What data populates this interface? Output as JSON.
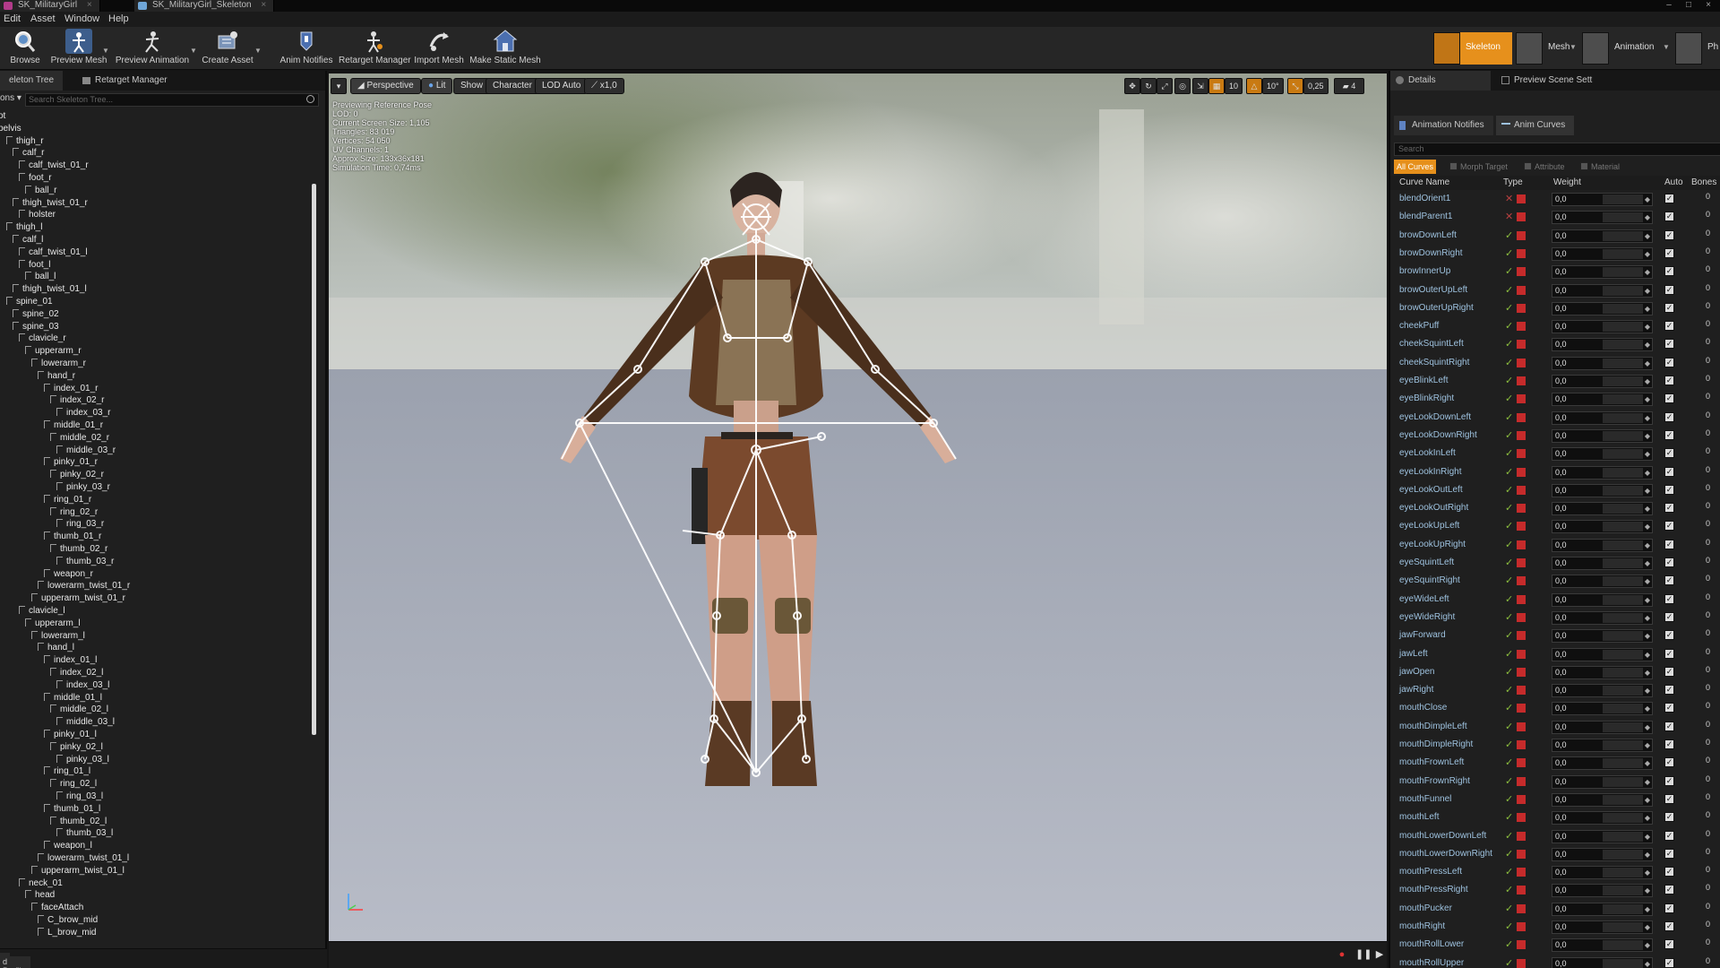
{
  "window": {
    "doc_tabs": [
      "SK_MilitaryGirl",
      "SK_MilitaryGirl_Skeleton"
    ]
  },
  "menu": [
    "Edit",
    "Asset",
    "Window",
    "Help"
  ],
  "toolbar": {
    "buttons": [
      {
        "label": "Browse",
        "icon": "magnifier-icon"
      },
      {
        "label": "Preview Mesh",
        "icon": "mesh-icon"
      },
      {
        "label": "Preview Animation",
        "icon": "animation-icon"
      },
      {
        "label": "Create Asset",
        "icon": "create-asset-icon"
      },
      {
        "label": "Anim Notifies",
        "icon": "notify-icon"
      },
      {
        "label": "Retarget Manager",
        "icon": "retarget-icon"
      },
      {
        "label": "Import Mesh",
        "icon": "import-icon"
      },
      {
        "label": "Make Static Mesh",
        "icon": "static-mesh-icon"
      }
    ],
    "modes": [
      {
        "label": "Skeleton",
        "active": true
      },
      {
        "label": "Mesh",
        "active": false
      },
      {
        "label": "Animation",
        "active": false
      },
      {
        "label": "Ph",
        "active": false
      }
    ]
  },
  "left_panel": {
    "tabs": [
      "eleton Tree",
      "Retarget Manager"
    ],
    "options_label": "ons",
    "search_placeholder": "Search Skeleton Tree...",
    "footer": "d Profile: None",
    "bones": [
      {
        "name": "ot",
        "depth": 0
      },
      {
        "name": "pelvis",
        "depth": 0
      },
      {
        "name": "thigh_r",
        "depth": 1
      },
      {
        "name": "calf_r",
        "depth": 2
      },
      {
        "name": "calf_twist_01_r",
        "depth": 3
      },
      {
        "name": "foot_r",
        "depth": 3
      },
      {
        "name": "ball_r",
        "depth": 4
      },
      {
        "name": "thigh_twist_01_r",
        "depth": 2
      },
      {
        "name": "holster",
        "depth": 3
      },
      {
        "name": "thigh_l",
        "depth": 1
      },
      {
        "name": "calf_l",
        "depth": 2
      },
      {
        "name": "calf_twist_01_l",
        "depth": 3
      },
      {
        "name": "foot_l",
        "depth": 3
      },
      {
        "name": "ball_l",
        "depth": 4
      },
      {
        "name": "thigh_twist_01_l",
        "depth": 2
      },
      {
        "name": "spine_01",
        "depth": 1
      },
      {
        "name": "spine_02",
        "depth": 2
      },
      {
        "name": "spine_03",
        "depth": 2
      },
      {
        "name": "clavicle_r",
        "depth": 3
      },
      {
        "name": "upperarm_r",
        "depth": 4
      },
      {
        "name": "lowerarm_r",
        "depth": 5
      },
      {
        "name": "hand_r",
        "depth": 6
      },
      {
        "name": "index_01_r",
        "depth": 7
      },
      {
        "name": "index_02_r",
        "depth": 8
      },
      {
        "name": "index_03_r",
        "depth": 9
      },
      {
        "name": "middle_01_r",
        "depth": 7
      },
      {
        "name": "middle_02_r",
        "depth": 8
      },
      {
        "name": "middle_03_r",
        "depth": 9
      },
      {
        "name": "pinky_01_r",
        "depth": 7
      },
      {
        "name": "pinky_02_r",
        "depth": 8
      },
      {
        "name": "pinky_03_r",
        "depth": 9
      },
      {
        "name": "ring_01_r",
        "depth": 7
      },
      {
        "name": "ring_02_r",
        "depth": 8
      },
      {
        "name": "ring_03_r",
        "depth": 9
      },
      {
        "name": "thumb_01_r",
        "depth": 7
      },
      {
        "name": "thumb_02_r",
        "depth": 8
      },
      {
        "name": "thumb_03_r",
        "depth": 9
      },
      {
        "name": "weapon_r",
        "depth": 7
      },
      {
        "name": "lowerarm_twist_01_r",
        "depth": 6
      },
      {
        "name": "upperarm_twist_01_r",
        "depth": 5
      },
      {
        "name": "clavicle_l",
        "depth": 3
      },
      {
        "name": "upperarm_l",
        "depth": 4
      },
      {
        "name": "lowerarm_l",
        "depth": 5
      },
      {
        "name": "hand_l",
        "depth": 6
      },
      {
        "name": "index_01_l",
        "depth": 7
      },
      {
        "name": "index_02_l",
        "depth": 8
      },
      {
        "name": "index_03_l",
        "depth": 9
      },
      {
        "name": "middle_01_l",
        "depth": 7
      },
      {
        "name": "middle_02_l",
        "depth": 8
      },
      {
        "name": "middle_03_l",
        "depth": 9
      },
      {
        "name": "pinky_01_l",
        "depth": 7
      },
      {
        "name": "pinky_02_l",
        "depth": 8
      },
      {
        "name": "pinky_03_l",
        "depth": 9
      },
      {
        "name": "ring_01_l",
        "depth": 7
      },
      {
        "name": "ring_02_l",
        "depth": 8
      },
      {
        "name": "ring_03_l",
        "depth": 9
      },
      {
        "name": "thumb_01_l",
        "depth": 7
      },
      {
        "name": "thumb_02_l",
        "depth": 8
      },
      {
        "name": "thumb_03_l",
        "depth": 9
      },
      {
        "name": "weapon_l",
        "depth": 7
      },
      {
        "name": "lowerarm_twist_01_l",
        "depth": 6
      },
      {
        "name": "upperarm_twist_01_l",
        "depth": 5
      },
      {
        "name": "neck_01",
        "depth": 3
      },
      {
        "name": "head",
        "depth": 4
      },
      {
        "name": "faceAttach",
        "depth": 5
      },
      {
        "name": "C_brow_mid",
        "depth": 6
      },
      {
        "name": "L_brow_mid",
        "depth": 6
      }
    ]
  },
  "viewport": {
    "buttons": {
      "perspective": "Perspective",
      "lit": "Lit",
      "show": "Show",
      "character": "Character",
      "lod": "LOD Auto",
      "speed": "x1,0"
    },
    "right_controls": {
      "grid_value": "10",
      "angle_value": "10°",
      "scale_value": "0,25",
      "camera_speed": "4"
    },
    "stats": [
      "Previewing Reference Pose",
      "LOD: 0",
      "Current Screen Size: 1,105",
      "Triangles: 83 019",
      "Vertices: 54 050",
      "UV Channels: 1",
      "Approx Size: 133x36x181",
      "Simulation Time: 0,74ms"
    ]
  },
  "right_panel": {
    "top_tabs": [
      "Details",
      "Preview Scene Sett"
    ],
    "sub_tabs": [
      "Animation Notifies",
      "Anim Curves"
    ],
    "search_placeholder": "Search",
    "filters": [
      "All Curves",
      "Morph Target",
      "Attribute",
      "Material"
    ],
    "columns": {
      "name": "Curve Name",
      "type": "Type",
      "weight": "Weight",
      "auto": "Auto",
      "bones": "Bones"
    },
    "curves": [
      "blendOrient1",
      "blendParent1",
      "browDownLeft",
      "browDownRight",
      "browInnerUp",
      "browOuterUpLeft",
      "browOuterUpRight",
      "cheekPuff",
      "cheekSquintLeft",
      "cheekSquintRight",
      "eyeBlinkLeft",
      "eyeBlinkRight",
      "eyeLookDownLeft",
      "eyeLookDownRight",
      "eyeLookInLeft",
      "eyeLookInRight",
      "eyeLookOutLeft",
      "eyeLookOutRight",
      "eyeLookUpLeft",
      "eyeLookUpRight",
      "eyeSquintLeft",
      "eyeSquintRight",
      "eyeWideLeft",
      "eyeWideRight",
      "jawForward",
      "jawLeft",
      "jawOpen",
      "jawRight",
      "mouthClose",
      "mouthDimpleLeft",
      "mouthDimpleRight",
      "mouthFrownLeft",
      "mouthFrownRight",
      "mouthFunnel",
      "mouthLeft",
      "mouthLowerDownLeft",
      "mouthLowerDownRight",
      "mouthPressLeft",
      "mouthPressRight",
      "mouthPucker",
      "mouthRight",
      "mouthRollLower",
      "mouthRollUpper"
    ],
    "weight_value": "0,0",
    "bones_value": "0"
  },
  "colors": {
    "accent": "#e6901c",
    "morph_target_icon": "#8bbd3e",
    "material_icon": "#c62b2b",
    "curve_name": "#9ec2df"
  }
}
